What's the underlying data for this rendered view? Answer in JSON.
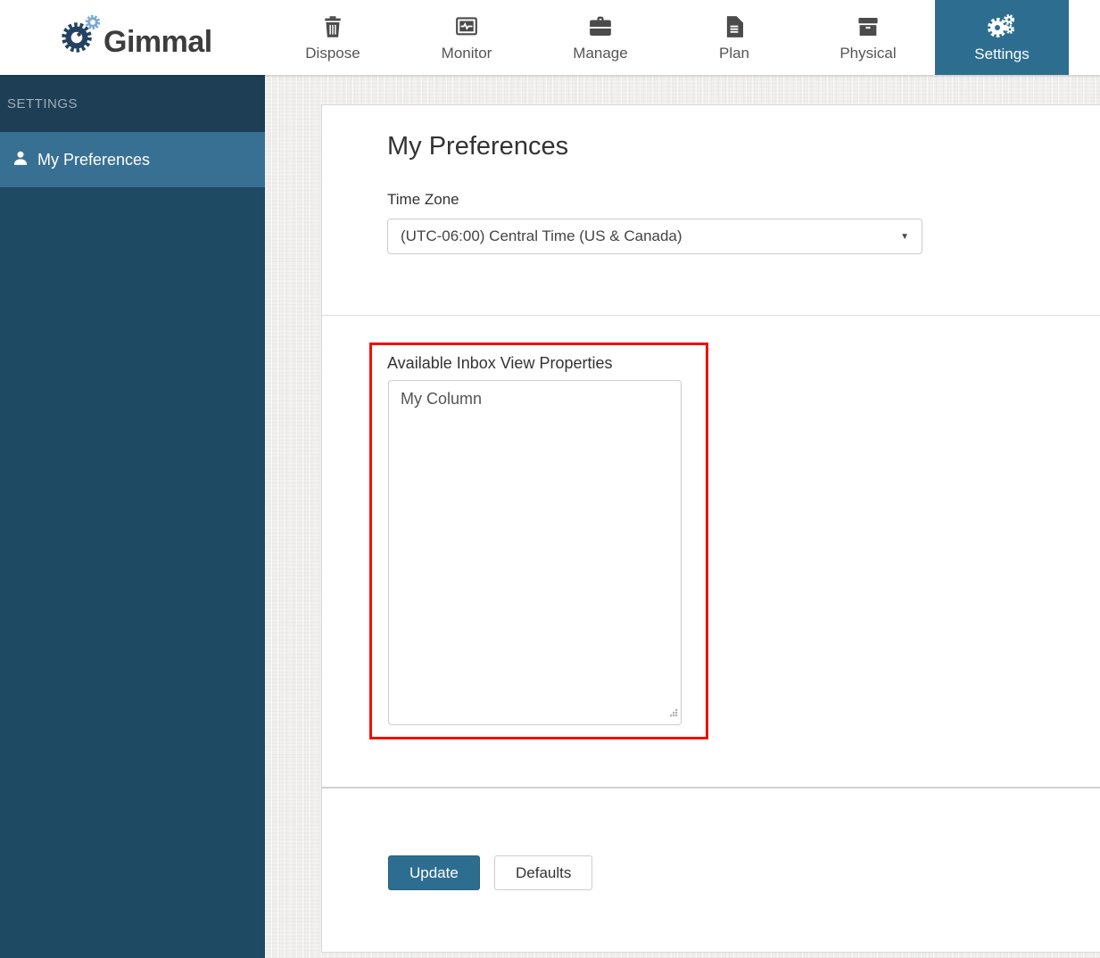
{
  "brand": {
    "name": "Gimmal"
  },
  "nav": {
    "items": [
      {
        "label": "Dispose",
        "icon": "trash-icon",
        "active": false
      },
      {
        "label": "Monitor",
        "icon": "monitor-pulse-icon",
        "active": false
      },
      {
        "label": "Manage",
        "icon": "briefcase-icon",
        "active": false
      },
      {
        "label": "Plan",
        "icon": "document-icon",
        "active": false
      },
      {
        "label": "Physical",
        "icon": "archive-box-icon",
        "active": false
      },
      {
        "label": "Settings",
        "icon": "gears-icon",
        "active": true
      }
    ]
  },
  "sidebar": {
    "heading": "SETTINGS",
    "items": [
      {
        "label": "My Preferences",
        "icon": "user-icon",
        "active": true
      }
    ]
  },
  "main": {
    "title": "My Preferences",
    "timezone": {
      "label": "Time Zone",
      "value": "(UTC-06:00) Central Time (US & Canada)"
    },
    "inbox_properties": {
      "label": "Available Inbox View Properties",
      "items": [
        "My Column"
      ]
    },
    "buttons": {
      "update": "Update",
      "defaults": "Defaults"
    }
  },
  "annotation": {
    "type": "red-highlight-box"
  },
  "colors": {
    "accent_teal": "#2d6e90",
    "sidebar_dark": "#1e4a63",
    "sidebar_header": "#1d3e55",
    "sidebar_active": "#387093",
    "annotation_red": "#ee1100",
    "logo_gear_dark": "#234263",
    "logo_gear_light": "#7fa8d4"
  }
}
